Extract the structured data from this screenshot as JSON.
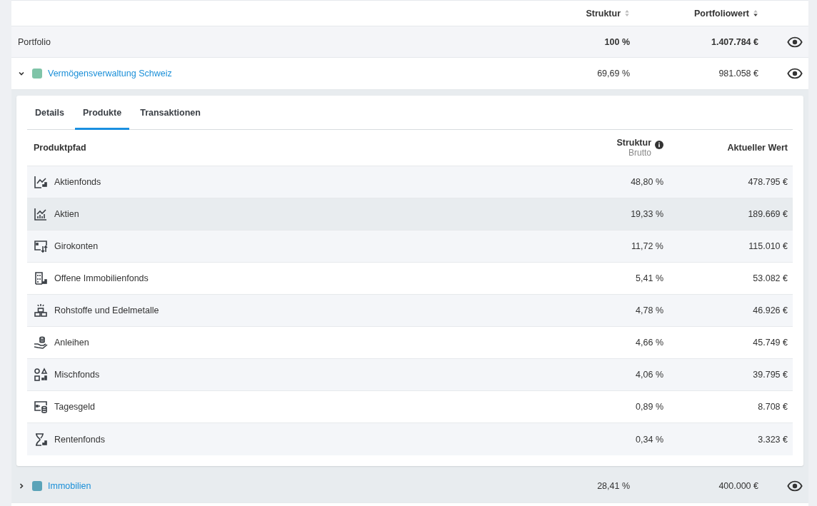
{
  "header": {
    "columns": [
      {
        "label": "Struktur",
        "sorted": false
      },
      {
        "label": "Portfoliowert",
        "sorted": true
      }
    ]
  },
  "portfolio": {
    "name": "Portfolio",
    "share": "100 %",
    "value": "1.407.784 €"
  },
  "groups": [
    {
      "name": "Vermögensverwaltung Schweiz",
      "color": "#7fc4a8",
      "expanded": true,
      "share": "69,69 %",
      "value": "981.058 €",
      "tabs": [
        {
          "label": "Details",
          "selected": false
        },
        {
          "label": "Produkte",
          "selected": true
        },
        {
          "label": "Transaktionen",
          "selected": false
        }
      ],
      "table": {
        "columns": [
          {
            "label": "Produktpfad"
          },
          {
            "label": "Struktur",
            "sublabel": "Brutto"
          },
          {
            "label": "Aktueller Wert"
          }
        ],
        "rows": [
          {
            "kind": "equity-fund",
            "name": "Aktienfonds",
            "share": "48,80 %",
            "value": "478.795 €",
            "highlighted": false
          },
          {
            "kind": "equity",
            "name": "Aktien",
            "share": "19,33 %",
            "value": "189.669 €",
            "highlighted": true
          },
          {
            "kind": "current-account",
            "name": "Girokonten",
            "share": "11,72 %",
            "value": "115.010 €",
            "highlighted": false
          },
          {
            "kind": "real-estate-fund",
            "name": "Offene Immobilienfonds",
            "share": "5,41 %",
            "value": "53.082 €",
            "highlighted": false
          },
          {
            "kind": "commodity",
            "name": "Rohstoffe und Edelmetalle",
            "share": "4,78 %",
            "value": "46.926 €",
            "highlighted": false
          },
          {
            "kind": "bond",
            "name": "Anleihen",
            "share": "4,66 %",
            "value": "45.749 €",
            "highlighted": false
          },
          {
            "kind": "mixed-fund",
            "name": "Mischfonds",
            "share": "4,06 %",
            "value": "39.795 €",
            "highlighted": false
          },
          {
            "kind": "overnight",
            "name": "Tagesgeld",
            "share": "0,89 %",
            "value": "8.708 €",
            "highlighted": false
          },
          {
            "kind": "bond-fund",
            "name": "Rentenfonds",
            "share": "0,34 %",
            "value": "3.323 €",
            "highlighted": false
          }
        ]
      }
    },
    {
      "name": "Immobilien",
      "color": "#5aa3b8",
      "expanded": false,
      "share": "28,41 %",
      "value": "400.000 €"
    }
  ]
}
